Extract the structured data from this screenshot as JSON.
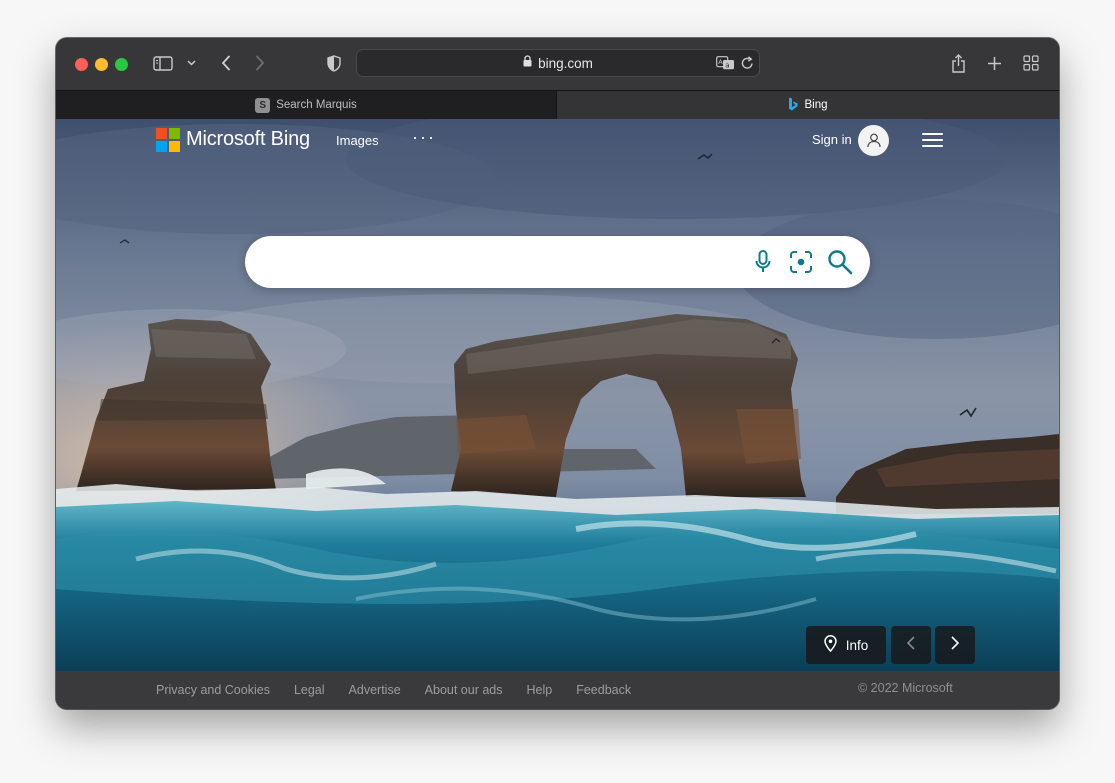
{
  "browser": {
    "address": "bing.com",
    "tabs": [
      {
        "label": "Search Marquis",
        "favicon": "S",
        "active": false
      },
      {
        "label": "Bing",
        "active": true
      }
    ]
  },
  "bing": {
    "brand": "Microsoft Bing",
    "nav": {
      "images": "Images",
      "more": "···"
    },
    "sign_in": "Sign in",
    "search": {
      "value": "",
      "placeholder": ""
    },
    "info_label": "Info",
    "logo_colors": [
      "#f25022",
      "#7fba00",
      "#00a4ef",
      "#ffb900"
    ],
    "accent": "#0e7a8a"
  },
  "footer": {
    "links": [
      "Privacy and Cookies",
      "Legal",
      "Advertise",
      "About our ads",
      "Help",
      "Feedback"
    ],
    "copyright": "© 2022 Microsoft"
  }
}
